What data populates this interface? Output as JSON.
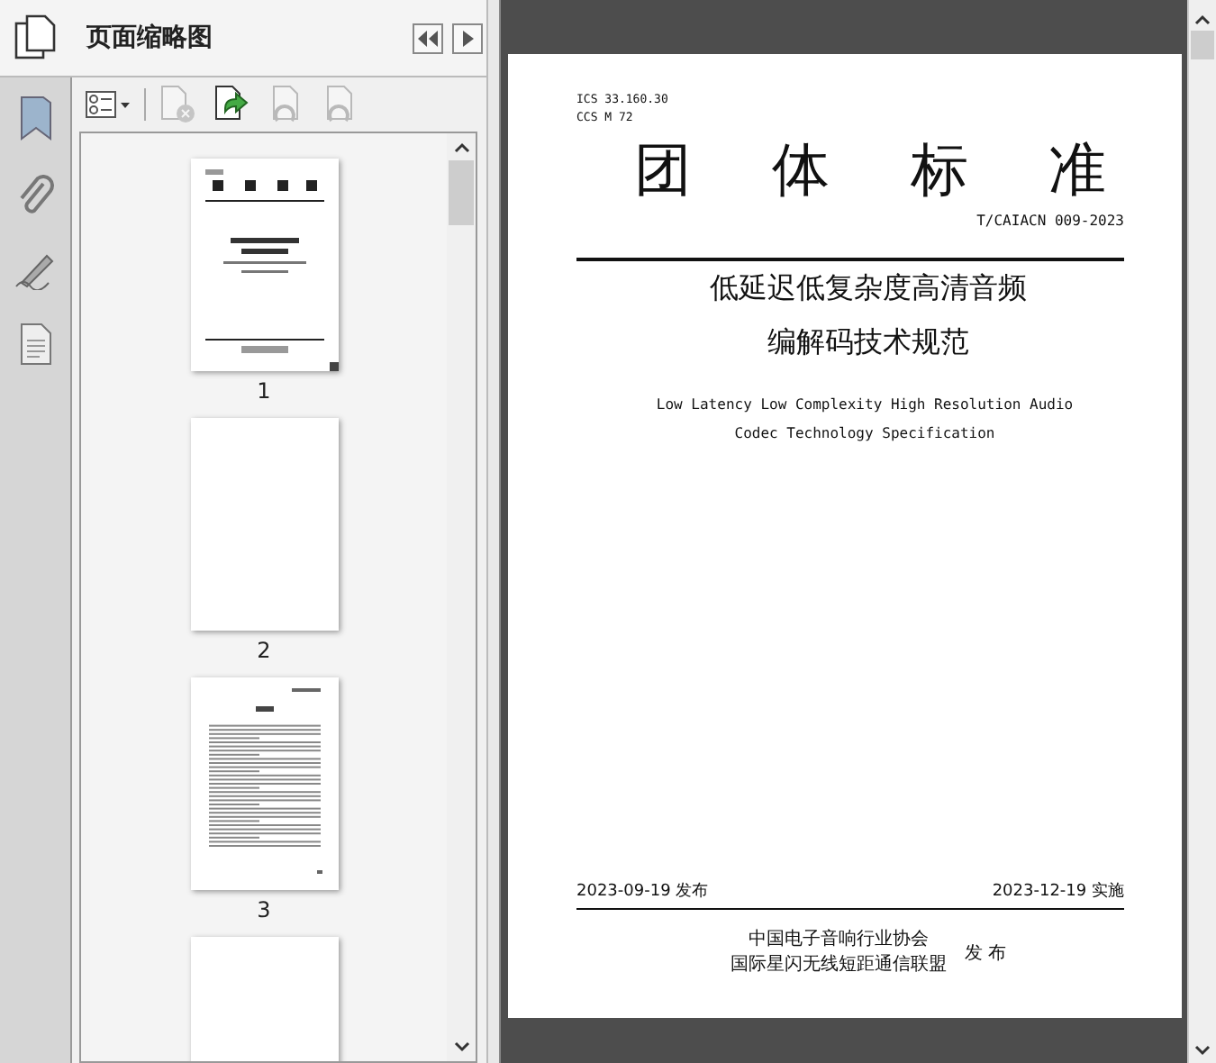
{
  "panel": {
    "title": "页面缩略图",
    "toolbar": [
      {
        "kind": "options",
        "disabled": false
      },
      {
        "kind": "delete",
        "disabled": true
      },
      {
        "kind": "insert",
        "disabled": false
      },
      {
        "kind": "undo",
        "disabled": true
      },
      {
        "kind": "redo",
        "disabled": true
      }
    ],
    "thumbnails": [
      {
        "kind": "cover",
        "label": "1"
      },
      {
        "kind": "blank",
        "label": "2"
      },
      {
        "kind": "contents",
        "label": "3"
      },
      {
        "kind": "blank"
      }
    ]
  },
  "document": {
    "ics": "ICS 33.160.30",
    "ccs": "CCS M 72",
    "title_chars": [
      "团",
      "体",
      "标",
      "准"
    ],
    "code": "T/CAIACN 009-2023",
    "cn_title": [
      "低延迟低复杂度高清音频",
      "编解码技术规范"
    ],
    "en_title": [
      "Low Latency Low Complexity High Resolution Audio",
      "Codec Technology Specification"
    ],
    "publish_date": "2023-09-19 发布",
    "implement_date": "2023-12-19 实施",
    "publishers": [
      "中国电子音响行业协会",
      "国际星闪无线短距通信联盟"
    ],
    "publish_word": "发 布"
  }
}
